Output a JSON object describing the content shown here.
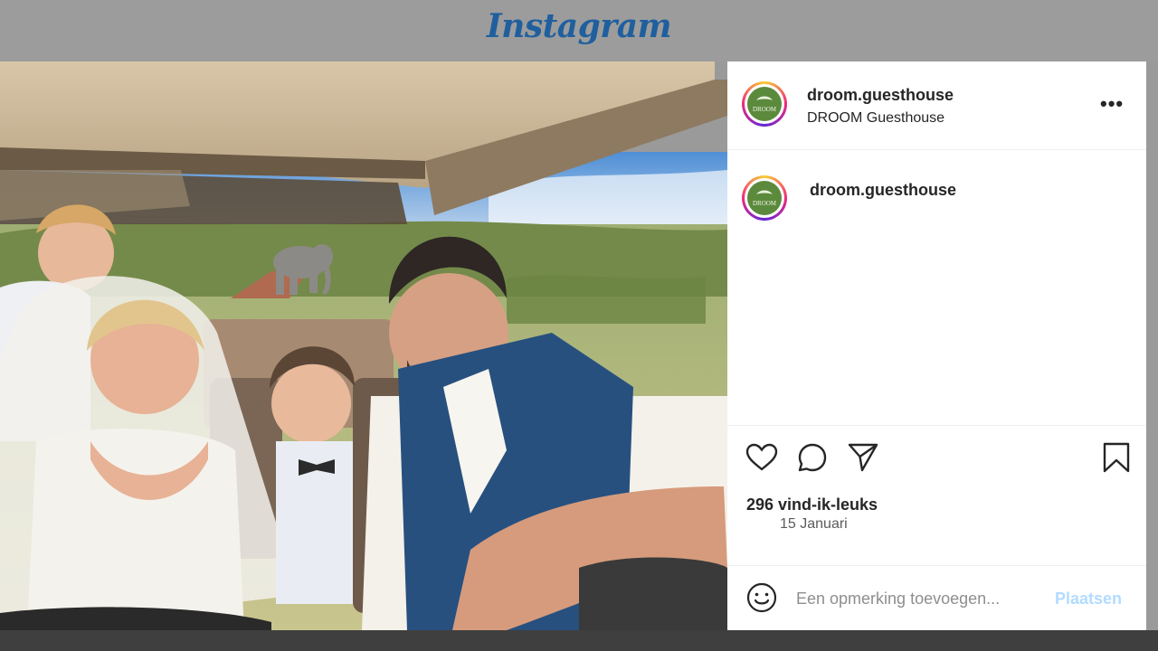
{
  "app": {
    "logo": "Instagram"
  },
  "post": {
    "account": {
      "username": "droom.guesthouse",
      "display_name": "DROOM Guesthouse",
      "avatar_text": "DROOM"
    },
    "caption_author": "droom.guesthouse",
    "likes": "296 vind-ik-leuks",
    "date": "15 Januari"
  },
  "comment": {
    "placeholder": "Een opmerking toevoegen...",
    "post_label": "Plaatsen"
  },
  "icons": {
    "more": "more-icon",
    "like": "heart-icon",
    "comment": "comment-icon",
    "share": "send-icon",
    "save": "bookmark-icon",
    "emoji": "emoji-icon"
  },
  "colors": {
    "logo": "#1f5f9e",
    "post_button": "#b3dbff",
    "avatar_bg": "#5c8a3c"
  }
}
